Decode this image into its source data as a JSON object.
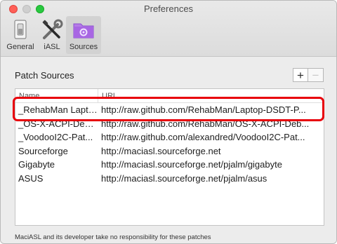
{
  "window": {
    "title": "Preferences"
  },
  "toolbar": {
    "items": [
      {
        "label": "General",
        "icon": "switch-icon"
      },
      {
        "label": "iASL",
        "icon": "tools-icon"
      },
      {
        "label": "Sources",
        "icon": "folder-gear-icon",
        "selected": true
      }
    ]
  },
  "patch_sources": {
    "title": "Patch Sources",
    "add_label": "+",
    "remove_label": "−",
    "columns": {
      "name": "Name",
      "url": "URL"
    },
    "rows": [
      {
        "name": "_RehabMan Laptop",
        "url": "http://raw.github.com/RehabMan/Laptop-DSDT-P..."
      },
      {
        "name": "_OS-X-ACPI-Debug",
        "url": "http://raw.github.com/RehabMan/OS-X-ACPI-Deb..."
      },
      {
        "name": "_VoodooI2C-Pat...",
        "url": "http://raw.github.com/alexandred/VoodooI2C-Pat..."
      },
      {
        "name": "Sourceforge",
        "url": "http://maciasl.sourceforge.net"
      },
      {
        "name": "Gigabyte",
        "url": "http://maciasl.sourceforge.net/pjalm/gigabyte"
      },
      {
        "name": "ASUS",
        "url": "http://maciasl.sourceforge.net/pjalm/asus"
      }
    ]
  },
  "footer": {
    "disclaimer": "MaciASL and its developer take no responsibility for these patches"
  },
  "colors": {
    "highlight": "#e8000a",
    "accent": "#9b59d8"
  }
}
